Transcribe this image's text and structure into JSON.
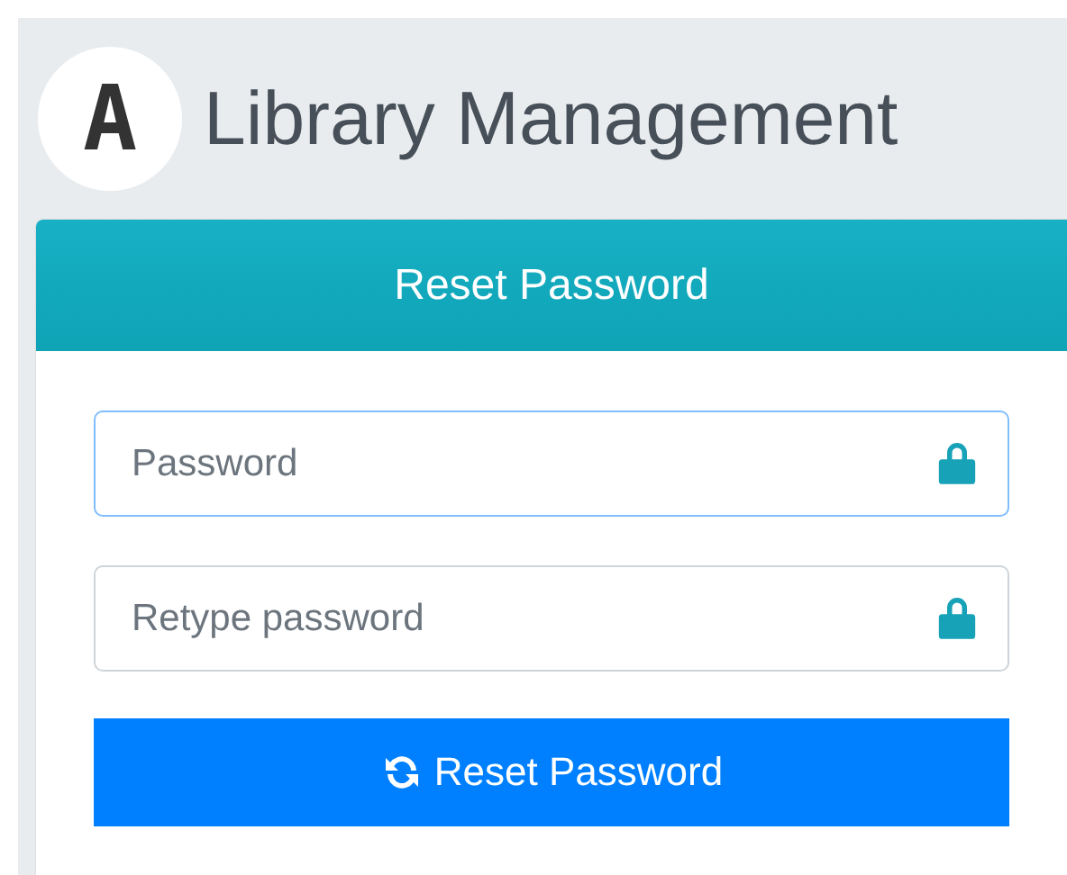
{
  "header": {
    "logo_letter": "A",
    "title": "Library Management"
  },
  "card": {
    "title": "Reset Password",
    "fields": [
      {
        "placeholder": "Password",
        "focused": true
      },
      {
        "placeholder": "Retype password",
        "focused": false
      }
    ],
    "submit": "Reset Password"
  }
}
